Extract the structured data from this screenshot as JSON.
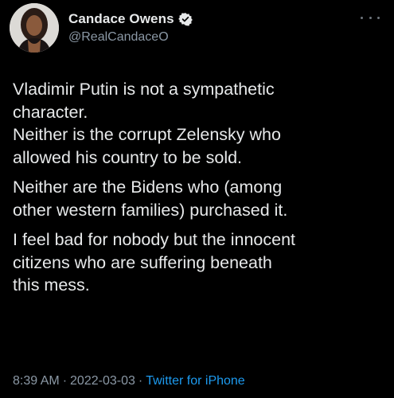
{
  "author": {
    "display_name": "Candace Owens",
    "handle": "@RealCandaceO",
    "verified": true,
    "avatar_icon": "profile-photo"
  },
  "tweet": {
    "paragraphs": [
      [
        "Vladimir Putin is not a sympathetic",
        "character.",
        "Neither is the corrupt Zelensky who",
        "allowed his country to be sold."
      ],
      [
        "Neither are the Bidens who (among",
        "other western families) purchased it."
      ],
      [
        "I feel bad for nobody but the innocent",
        "citizens who are suffering beneath",
        "this mess."
      ]
    ]
  },
  "meta": {
    "time": "8:39 AM",
    "separator": "·",
    "date": "2022-03-03",
    "source": "Twitter for iPhone"
  },
  "colors": {
    "background": "#000000",
    "text": "#e7e9ea",
    "secondary": "#8b98a5",
    "link": "#1d9bf0"
  }
}
